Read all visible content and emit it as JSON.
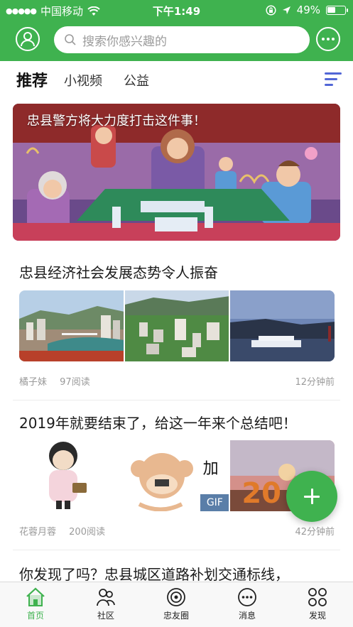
{
  "status_bar": {
    "carrier": "中国移动",
    "time": "下午1:49",
    "battery": "49%"
  },
  "search": {
    "placeholder": "搜索你感兴趣的"
  },
  "tabs": [
    {
      "label": "推荐",
      "active": true
    },
    {
      "label": "小视频",
      "active": false
    },
    {
      "label": "公益",
      "active": false
    }
  ],
  "banner": {
    "title": "忠县警方将大力度打击这件事！"
  },
  "articles": [
    {
      "title": "忠县经济社会发展态势令人振奋",
      "author": "橘子妹",
      "reads": "97阅读",
      "time": "12分钟前"
    },
    {
      "title": "2019年就要结束了，给这一年来个总结吧！",
      "author": "花蓉月蓉",
      "reads": "200阅读",
      "time": "42分钟前",
      "gif_label": "GIF",
      "image_text_1": "加",
      "image_text_2": "20"
    },
    {
      "title": "你发现了吗？忠县城区道路补划交通标线，"
    }
  ],
  "bottom_nav": [
    {
      "label": "首页",
      "icon": "home-icon",
      "active": true
    },
    {
      "label": "社区",
      "icon": "community-icon",
      "active": false
    },
    {
      "label": "忠友圈",
      "icon": "circle-icon",
      "active": false
    },
    {
      "label": "消息",
      "icon": "message-icon",
      "active": false
    },
    {
      "label": "发现",
      "icon": "discover-icon",
      "active": false
    }
  ],
  "colors": {
    "brand_green": "#3fb24f",
    "menu_blue": "#5166d6"
  }
}
